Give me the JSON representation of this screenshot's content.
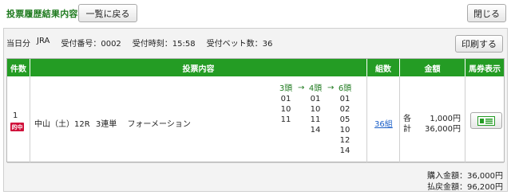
{
  "header": {
    "title": "投票履歴結果内容",
    "back_label": "一覧に戻る",
    "close_label": "閉じる"
  },
  "info": {
    "day": "当日分",
    "org": "JRA",
    "receipt_no": "受付番号：0002",
    "receipt_time": "受付時刻：15:58",
    "bet_count": "受付ベット数：36",
    "print_label": "印刷する"
  },
  "table": {
    "columns": [
      "件数",
      "投票内容",
      "組数",
      "金額",
      "馬券表示"
    ],
    "row": {
      "index": "1",
      "hit_badge": "的中",
      "race": "中山（土）12R",
      "bet_type": "3連単",
      "method": "フォーメーション",
      "formation": [
        {
          "head": "3頭",
          "numbers": [
            "01",
            "10",
            "11"
          ]
        },
        {
          "head": "4頭",
          "numbers": [
            "01",
            "10",
            "11",
            "14"
          ]
        },
        {
          "head": "6頭",
          "numbers": [
            "01",
            "02",
            "05",
            "10",
            "12",
            "14"
          ]
        }
      ],
      "arrow": "→",
      "combos": "36組",
      "amount_each_label": "各",
      "amount_each": "1,000円",
      "amount_total_label": "計",
      "amount_total": "36,000円",
      "ticket_icon": "ticket-icon"
    }
  },
  "summary": {
    "purchase_label": "購入金額：",
    "purchase_value": "36,000円",
    "payout_label": "払戻金額：",
    "payout_value": "96,200円"
  },
  "colors": {
    "accent": "#249c24",
    "title": "#1e7a1e",
    "hit": "#d0103a",
    "link": "#1a5ec7"
  }
}
